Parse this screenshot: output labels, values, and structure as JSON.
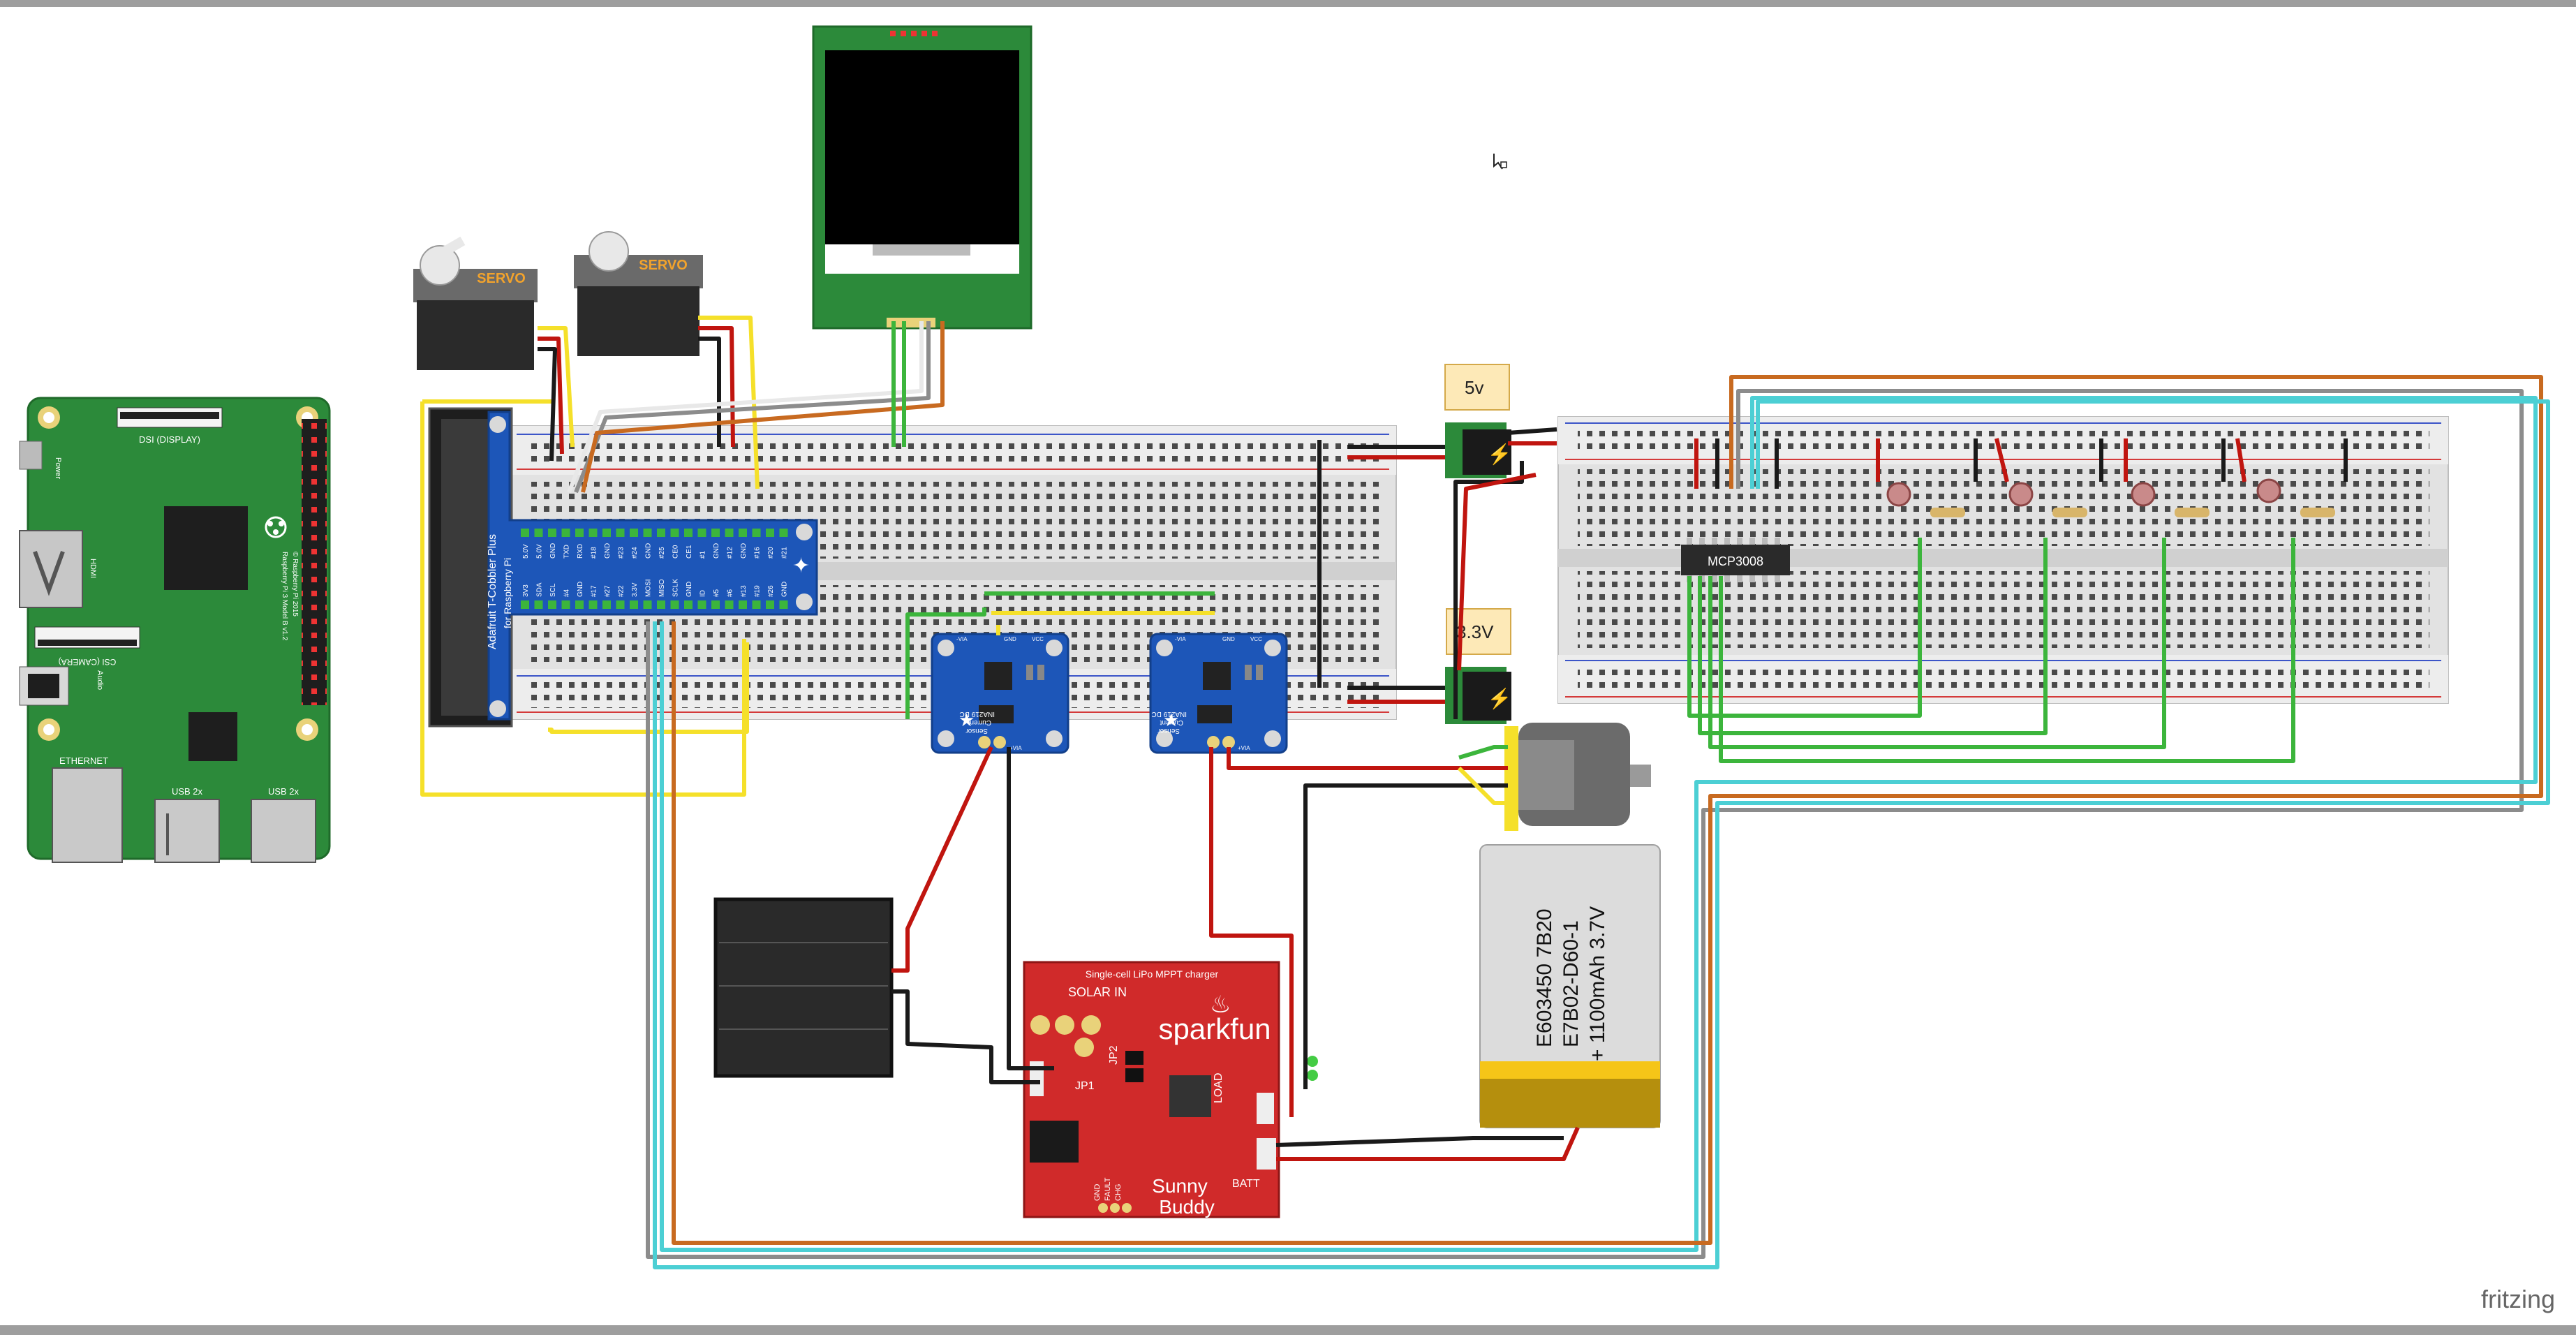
{
  "app": {
    "brand": "fritzing"
  },
  "raspberry_pi": {
    "dsi_label": "DSI (DISPLAY)",
    "power_label": "Power",
    "hdmi_label": "HDMI",
    "csi_label": "CSI (CAMERA)",
    "audio_label": "Audio",
    "ethernet_label": "ETHERNET",
    "usb1_label": "USB 2x",
    "usb2_label": "USB 2x",
    "model_label": "Raspberry Pi 3 Model B v1.2",
    "copyright_label": "© Raspberry Pi 2015"
  },
  "cobbler": {
    "title": "Adafruit T-Cobbler Plus",
    "subtitle": "for Raspberry Pi",
    "pin_labels_top": [
      "5.0V",
      "5.0V",
      "GND",
      "TXD",
      "RXD",
      "#18",
      "GND",
      "#23",
      "#24",
      "GND",
      "#25",
      "CE0",
      "CE1",
      "#1",
      "GND",
      "#12",
      "GND",
      "#16",
      "#20",
      "#21"
    ],
    "pin_labels_bottom": [
      "3V3",
      "SDA",
      "SCL",
      "#4",
      "GND",
      "#17",
      "#27",
      "#22",
      "3.3V",
      "MOSI",
      "MISO",
      "SCLK",
      "GND",
      "ID",
      "#5",
      "#6",
      "#13",
      "#19",
      "#26",
      "GND"
    ]
  },
  "servos": [
    {
      "label": "SERVO"
    },
    {
      "label": "SERVO"
    }
  ],
  "power_labels": {
    "five_v": "5v",
    "three_v": "3.3V"
  },
  "adc": {
    "label": "MCP3008"
  },
  "ina219": [
    {
      "title": "INA219 DC",
      "subtitle": "Current",
      "sensor": "Sensor",
      "vin_plus": "+VIA",
      "vin_minus": "-VIA",
      "vcc": "VCC",
      "gnd": "GND",
      "sda": "SDA",
      "scl": "SCL"
    },
    {
      "title": "INA219 DC",
      "subtitle": "Current",
      "sensor": "Sensor",
      "vin_plus": "+VIA",
      "vin_minus": "-VIA",
      "vcc": "VCC",
      "gnd": "GND",
      "sda": "SDA",
      "scl": "SCL"
    }
  ],
  "charger": {
    "header": "Single-cell LiPo MPPT charger",
    "brand": "sparkfun",
    "solar_in": "SOLAR IN",
    "jp1": "JP1",
    "jp2": "JP2",
    "load": "LOAD",
    "batt": "BATT",
    "name_line1": "Sunny",
    "name_line2": "Buddy",
    "fault": "FAULT",
    "chg": "CHG",
    "gnd": "GND"
  },
  "battery": {
    "line1": "E603450 7B20",
    "line2": "E7B02-D60-1",
    "line3": "+ 1100mAh 3.7V"
  },
  "colors": {
    "wire_red": "#c0150f",
    "wire_black": "#1a1a1a",
    "wire_green": "#3cb53c",
    "wire_yellow": "#f5e02a",
    "wire_orange": "#c86a20",
    "wire_cyan": "#4ccfd4",
    "wire_gray": "#8c8c8c",
    "wire_white": "#e8e8e8",
    "pcb_green": "#2c8a3a",
    "pcb_blue": "#1d56b8",
    "pcb_red": "#d02a2a"
  }
}
